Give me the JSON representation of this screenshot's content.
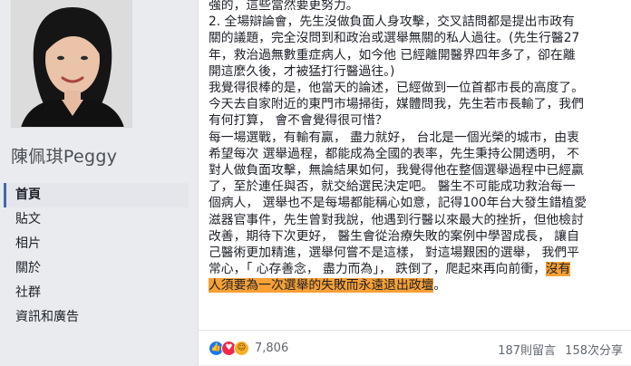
{
  "page": {
    "name": "陳佩琪Peggy",
    "nav": [
      {
        "label": "首頁",
        "active": true
      },
      {
        "label": "貼文",
        "active": false
      },
      {
        "label": "相片",
        "active": false
      },
      {
        "label": "關於",
        "active": false
      },
      {
        "label": "社群",
        "active": false
      },
      {
        "label": "資訊和廣告",
        "active": false
      }
    ]
  },
  "post": {
    "lines": [
      {
        "text": "強的，這些當然要更努力。"
      },
      {
        "text": "2. 全場辯論會，先生沒做負面人身攻擊，交叉詰問都是提出市政有"
      },
      {
        "text": "關的議題，完全沒問到和政治或選舉無關的私人過往。(先生行醫27"
      },
      {
        "text": "年，救治過無數重症病人，如今他 已經離開醫界四年多了，卻在離"
      },
      {
        "text": "開這麼久後，才被猛打行醫過往。)"
      },
      {
        "text": "我覺得很棒的是，他當天的論述，已經做到一位首都市長的高度了。"
      },
      {
        "text": "今天去自家附近的東門市場掃街，媒體問我，先生若市長輸了，我們"
      },
      {
        "text": "有何打算， 會不會覺得很可惜？"
      },
      {
        "text": "每一場選戰，有輸有贏， 盡力就好， 台北是一個光榮的城市，由衷"
      },
      {
        "text": "希望每次 選舉過程，都能成為全國的表率，先生秉持公開透明， 不"
      },
      {
        "text": "對人做負面攻擊，無論結果如何，我覺得他在整個選舉過程中已經贏"
      },
      {
        "text": "了，至於連任與否，就交給選民決定吧。 醫生不可能成功救治每一"
      },
      {
        "text": "個病人， 選舉也不是每場都能稱心如意，記得100年台大發生錯植愛"
      },
      {
        "text": "滋器官事件，先生曾對我說，他遇到行醫以來最大的挫折，但他檢討"
      },
      {
        "text": "改善，期待下次更好， 醫生會從治療失敗的案例中學習成長， 讓自"
      },
      {
        "text": "己醫術更加精進，選舉何嘗不是這樣， 對這場艱困的選舉， 我們平"
      },
      {
        "text": "常心，「 心存善念， 盡力而為」， 跌倒了，爬起來再向前衝，",
        "highlight": "沒有"
      },
      {
        "text": "",
        "highlight": "人須要為一次選舉的失敗而永遠退出政壇",
        "after": "。"
      }
    ],
    "reactions": {
      "icons": [
        "like-icon",
        "love-icon",
        "haha-icon"
      ],
      "count": "7,806"
    },
    "comments": "187則留言",
    "shares": "158次分享"
  },
  "colors": {
    "highlight": "#f7a035",
    "nav_active_bar": "#4267b2",
    "like": "#1877f2",
    "love": "#f0284a",
    "haha": "#f7b125"
  }
}
